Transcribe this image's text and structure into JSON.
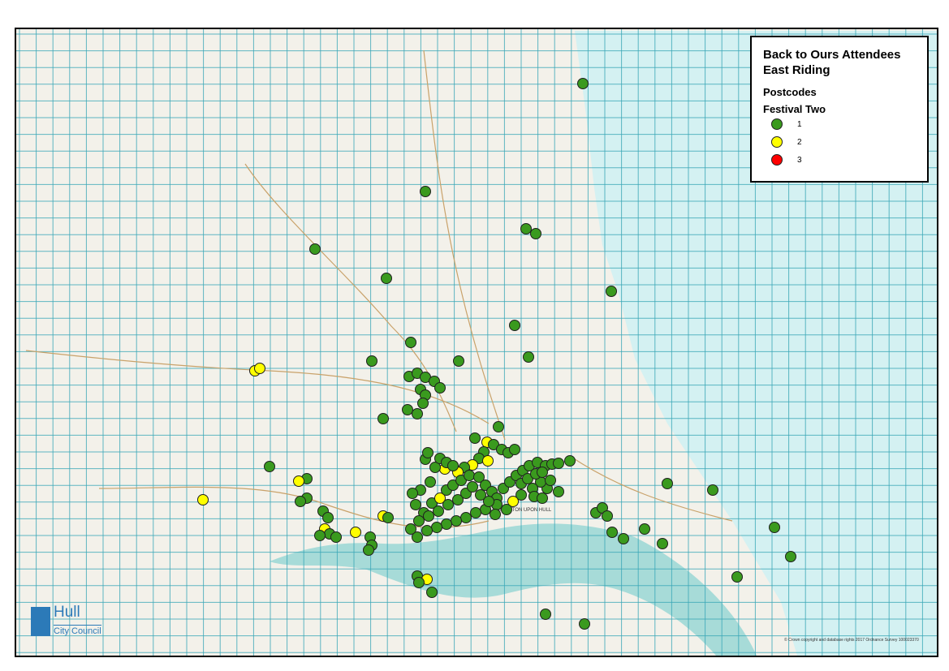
{
  "legend": {
    "title_line1": "Back to Ours Attendees",
    "title_line2": "East Riding",
    "layer": "Postcodes",
    "field": "Festival Two",
    "classes": [
      {
        "label": "1",
        "color": "#3a9a1e"
      },
      {
        "label": "2",
        "color": "#ffff00"
      },
      {
        "label": "3",
        "color": "#ff0000"
      }
    ]
  },
  "basemap": {
    "place_label": "KINGSTON UPON HULL",
    "land_color": "#f3f1ea",
    "sea_color": "#d4f1f2",
    "estuary_color": "#9fd8d6",
    "grid_color": "#3aa7b7"
  },
  "logo": {
    "name": "Hull",
    "subtitle": "City Council"
  },
  "copyright": "© Crown copyright and database rights 2017 Ordnance Survey 100023370",
  "points": [
    [
      716,
      101,
      1
    ],
    [
      522,
      234,
      1
    ],
    [
      646,
      280,
      1
    ],
    [
      658,
      286,
      1
    ],
    [
      386,
      305,
      1
    ],
    [
      474,
      341,
      1
    ],
    [
      751,
      357,
      1
    ],
    [
      632,
      399,
      1
    ],
    [
      504,
      420,
      1
    ],
    [
      456,
      443,
      1
    ],
    [
      563,
      443,
      1
    ],
    [
      649,
      438,
      1
    ],
    [
      312,
      455,
      2
    ],
    [
      318,
      452,
      2
    ],
    [
      502,
      462,
      1
    ],
    [
      512,
      458,
      1
    ],
    [
      522,
      463,
      1
    ],
    [
      533,
      468,
      1
    ],
    [
      540,
      476,
      1
    ],
    [
      516,
      478,
      1
    ],
    [
      522,
      485,
      1
    ],
    [
      519,
      495,
      1
    ],
    [
      500,
      503,
      1
    ],
    [
      512,
      508,
      1
    ],
    [
      470,
      514,
      1
    ],
    [
      583,
      538,
      1
    ],
    [
      598,
      543,
      2
    ],
    [
      606,
      546,
      1
    ],
    [
      612,
      524,
      1
    ],
    [
      616,
      552,
      1
    ],
    [
      624,
      556,
      1
    ],
    [
      632,
      552,
      1
    ],
    [
      594,
      555,
      1
    ],
    [
      588,
      563,
      1
    ],
    [
      599,
      566,
      2
    ],
    [
      580,
      571,
      2
    ],
    [
      570,
      574,
      1
    ],
    [
      562,
      580,
      2
    ],
    [
      546,
      576,
      2
    ],
    [
      534,
      574,
      1
    ],
    [
      522,
      564,
      1
    ],
    [
      525,
      556,
      1
    ],
    [
      540,
      563,
      1
    ],
    [
      548,
      568,
      1
    ],
    [
      556,
      572,
      1
    ],
    [
      528,
      592,
      1
    ],
    [
      516,
      602,
      1
    ],
    [
      506,
      606,
      1
    ],
    [
      510,
      620,
      1
    ],
    [
      520,
      630,
      1
    ],
    [
      530,
      618,
      1
    ],
    [
      540,
      612,
      2
    ],
    [
      548,
      602,
      1
    ],
    [
      556,
      596,
      1
    ],
    [
      566,
      590,
      1
    ],
    [
      576,
      584,
      1
    ],
    [
      588,
      586,
      1
    ],
    [
      596,
      596,
      1
    ],
    [
      604,
      604,
      1
    ],
    [
      610,
      612,
      1
    ],
    [
      618,
      600,
      1
    ],
    [
      626,
      592,
      1
    ],
    [
      634,
      584,
      1
    ],
    [
      642,
      578,
      1
    ],
    [
      650,
      572,
      1
    ],
    [
      660,
      568,
      1
    ],
    [
      670,
      572,
      1
    ],
    [
      678,
      570,
      1
    ],
    [
      686,
      569,
      1
    ],
    [
      700,
      566,
      1
    ],
    [
      686,
      604,
      1
    ],
    [
      672,
      600,
      1
    ],
    [
      664,
      592,
      1
    ],
    [
      654,
      600,
      1
    ],
    [
      640,
      608,
      1
    ],
    [
      630,
      616,
      2
    ],
    [
      622,
      626,
      1
    ],
    [
      610,
      620,
      1
    ],
    [
      596,
      626,
      1
    ],
    [
      584,
      630,
      1
    ],
    [
      572,
      636,
      1
    ],
    [
      560,
      640,
      1
    ],
    [
      548,
      644,
      1
    ],
    [
      536,
      648,
      1
    ],
    [
      524,
      652,
      1
    ],
    [
      512,
      660,
      1
    ],
    [
      504,
      650,
      1
    ],
    [
      514,
      640,
      1
    ],
    [
      526,
      634,
      1
    ],
    [
      538,
      628,
      1
    ],
    [
      550,
      620,
      1
    ],
    [
      562,
      614,
      1
    ],
    [
      572,
      606,
      1
    ],
    [
      580,
      598,
      1
    ],
    [
      590,
      608,
      1
    ],
    [
      600,
      616,
      1
    ],
    [
      640,
      594,
      1
    ],
    [
      648,
      588,
      1
    ],
    [
      658,
      582,
      1
    ],
    [
      666,
      580,
      1
    ],
    [
      676,
      590,
      1
    ],
    [
      656,
      610,
      1
    ],
    [
      666,
      612,
      1
    ],
    [
      608,
      632,
      1
    ],
    [
      330,
      573,
      1
    ],
    [
      376,
      588,
      1
    ],
    [
      366,
      591,
      2
    ],
    [
      376,
      612,
      1
    ],
    [
      368,
      616,
      1
    ],
    [
      248,
      614,
      2
    ],
    [
      396,
      628,
      1
    ],
    [
      402,
      636,
      1
    ],
    [
      398,
      650,
      2
    ],
    [
      404,
      656,
      1
    ],
    [
      412,
      660,
      1
    ],
    [
      392,
      658,
      1
    ],
    [
      470,
      634,
      2
    ],
    [
      476,
      636,
      1
    ],
    [
      436,
      654,
      2
    ],
    [
      454,
      660,
      1
    ],
    [
      456,
      670,
      1
    ],
    [
      452,
      676,
      1
    ],
    [
      732,
      630,
      1
    ],
    [
      740,
      624,
      1
    ],
    [
      746,
      634,
      1
    ],
    [
      752,
      654,
      1
    ],
    [
      766,
      662,
      1
    ],
    [
      792,
      650,
      1
    ],
    [
      814,
      668,
      1
    ],
    [
      820,
      594,
      1
    ],
    [
      876,
      602,
      1
    ],
    [
      952,
      648,
      1
    ],
    [
      972,
      684,
      1
    ],
    [
      906,
      709,
      1
    ],
    [
      512,
      708,
      1
    ],
    [
      524,
      712,
      2
    ],
    [
      514,
      716,
      1
    ],
    [
      530,
      728,
      1
    ],
    [
      670,
      755,
      1
    ],
    [
      718,
      767,
      1
    ]
  ]
}
